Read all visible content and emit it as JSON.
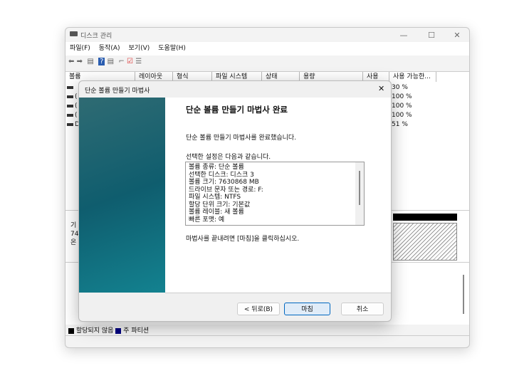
{
  "window": {
    "title": "디스크 관리",
    "minimize": "—",
    "maximize": "☐",
    "close": "✕"
  },
  "menu": [
    "파일(F)",
    "동작(A)",
    "보기(V)",
    "도움말(H)"
  ],
  "toolbar_icons": [
    "back-arrow-icon",
    "forward-arrow-icon",
    "console-tree-icon",
    "help-icon",
    "action-pane-icon",
    "connect-icon",
    "check-icon",
    "properties-icon"
  ],
  "columns": [
    "볼륨",
    "레이아웃",
    "형식",
    "파일 시스템",
    "상태",
    "용량",
    "사용 가...",
    "사용 가능한..."
  ],
  "rows_pct": [
    "30 %",
    "100 %",
    "100 %",
    "100 %",
    "51 %"
  ],
  "rows_prefix": [
    "",
    "(",
    "(",
    "(",
    "D"
  ],
  "disk": {
    "l1": "기",
    "l2": "74",
    "l3": "온"
  },
  "legend": {
    "unallocated": "할당되지 않음",
    "primary": "주 파티션"
  },
  "dialog": {
    "title": "단순 볼륨 만들기 마법사",
    "close": "✕",
    "heading": "단순 볼륨 만들기 마법사 완료",
    "done_text": "단순 볼륨 만들기 마법사를 완료했습니다.",
    "settings_label": "선택한 설정은 다음과 같습니다.",
    "summary": [
      "볼륨 종류: 단순 볼륨",
      "선택한 디스크: 디스크 3",
      "볼륨 크기: 7630868 MB",
      "드라이브 문자 또는 경로: F:",
      "파일 시스템: NTFS",
      "할당 단위 크기: 기본값",
      "볼륨 레이블: 새 볼륨",
      "빠른 포맷: 예"
    ],
    "finish_hint": "마법사를 끝내려면 [마침]을 클릭하십시오.",
    "back": "< 뒤로(B)",
    "finish": "마침",
    "cancel": "취소"
  },
  "colors": {
    "unallocated": "#000000",
    "primary": "#000080",
    "accent": "#0067c0"
  }
}
